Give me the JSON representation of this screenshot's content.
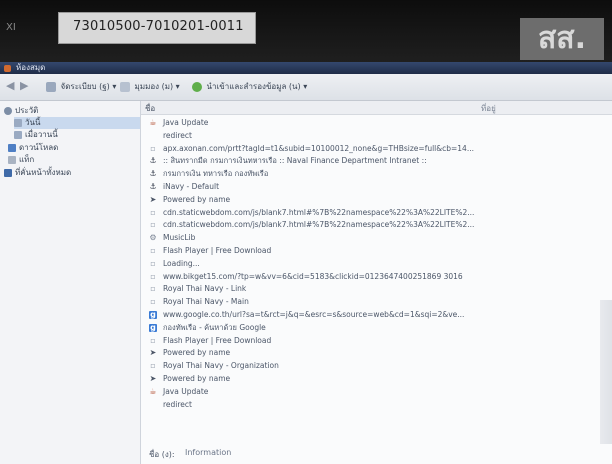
{
  "photo": {
    "sticker_id": "73010500-7010201-0011",
    "corner_text": "XI",
    "logo": "สส."
  },
  "window": {
    "title": "ห้องสมุด"
  },
  "toolbar": {
    "organize": "จัดระเบียบ (ฐ)",
    "views": "มุมมอง (ม)",
    "import_export": "นำเข้าและสำรองข้อมูล (น)"
  },
  "sidebar": {
    "items": [
      {
        "label": "ประวัติ",
        "icon": "clock-icon"
      },
      {
        "label": "วันนี้",
        "icon": "calendar-icon"
      },
      {
        "label": "เมื่อวานนี้",
        "icon": "calendar-icon"
      },
      {
        "label": "ดาวน์โหลด",
        "icon": "download-icon"
      },
      {
        "label": "แท็ก",
        "icon": "tag-icon"
      },
      {
        "label": "ที่คั่นหน้าทั้งหมด",
        "icon": "bookmark-icon"
      }
    ]
  },
  "main": {
    "col_name": "ชื่อ",
    "col_location": "ที่อยู่",
    "rows": [
      {
        "text": "Java Update",
        "icon": "java-icon"
      },
      {
        "text": "redirect",
        "icon": ""
      },
      {
        "text": "apx.axonan.com/prtt?tagId=t1&subid=10100012_none&g=THBsize=full&cb=14...",
        "icon": "page-icon"
      },
      {
        "text": ":: สินทรากมืด กรมการเงินทหารเรือ :: Naval Finance Department Intranet ::",
        "icon": "anchor-icon"
      },
      {
        "text": "กรมการเงิน ทหารเรือ กองทัพเรือ",
        "icon": "anchor-icon"
      },
      {
        "text": "iNavy - Default",
        "icon": "anchor-icon"
      },
      {
        "text": "Powered by name",
        "icon": "arrow-icon"
      },
      {
        "text": "cdn.staticwebdom.com/js/blank7.html#%7B%22namespace%22%3A%22LITE%2...",
        "icon": "page-icon"
      },
      {
        "text": "cdn.staticwebdom.com/js/blank7.html#%7B%22namespace%22%3A%22LITE%2...",
        "icon": "page-icon"
      },
      {
        "text": "MusicLib",
        "icon": "gear-icon"
      },
      {
        "text": "Flash Player | Free Download",
        "icon": "page-icon"
      },
      {
        "text": "Loading...",
        "icon": "page-icon"
      },
      {
        "text": "www.bikget15.com/?tp=w&vv=6&cid=5183&clickid=0123647400251869 3016",
        "icon": "page-icon"
      },
      {
        "text": "Royal Thai Navy - Link",
        "icon": "page-icon"
      },
      {
        "text": "Royal Thai Navy - Main",
        "icon": "page-icon"
      },
      {
        "text": "www.google.co.th/url?sa=t&rct=j&q=&esrc=s&source=web&cd=1&sqi=2&ve...",
        "icon": "google-icon"
      },
      {
        "text": "กองทัพเรือ - ค้นหาด้วย Google",
        "icon": "google-icon"
      },
      {
        "text": "Flash Player | Free Download",
        "icon": "page-icon"
      },
      {
        "text": "Powered by name",
        "icon": "arrow-icon"
      },
      {
        "text": "Royal Thai Navy - Organization",
        "icon": "page-icon"
      },
      {
        "text": "Powered by name",
        "icon": "arrow-icon"
      },
      {
        "text": "Java Update",
        "icon": "java-icon"
      },
      {
        "text": "redirect",
        "icon": ""
      }
    ]
  },
  "status": {
    "label": "ชื่อ (ง):",
    "info": "Information"
  },
  "colors": {
    "title_bar": "#2a3a5c",
    "sidebar_bg": "#f3f4f7",
    "accent": "#3a7bd5"
  }
}
